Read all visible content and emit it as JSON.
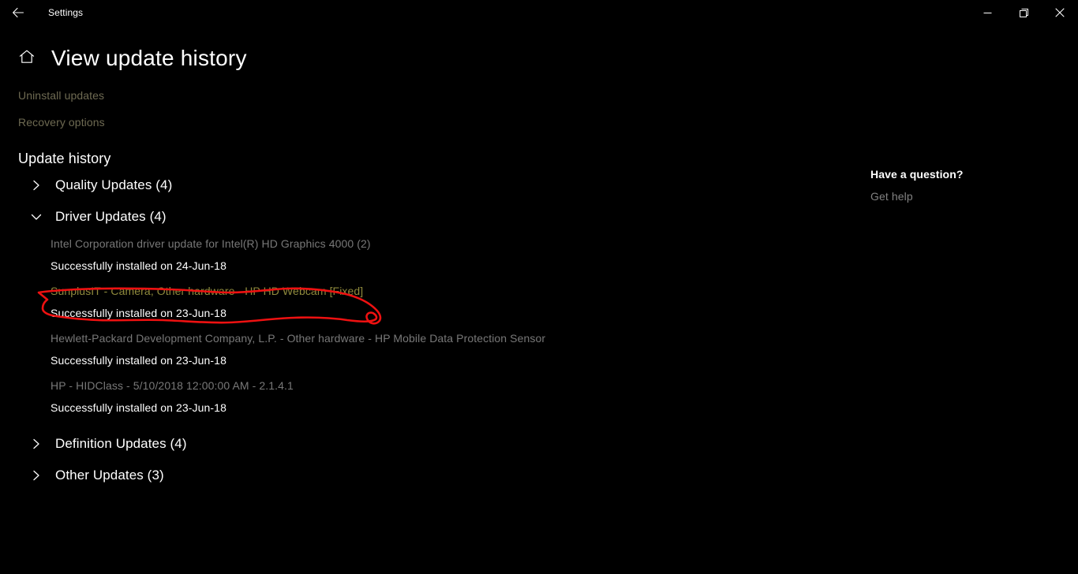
{
  "window": {
    "app_title": "Settings",
    "back_icon": "back-arrow-icon",
    "minimize_icon": "minimize-icon",
    "restore_icon": "restore-icon",
    "close_icon": "close-icon"
  },
  "header": {
    "home_icon": "home-icon",
    "title": "View update history"
  },
  "top_links": [
    {
      "label": "Uninstall updates"
    },
    {
      "label": "Recovery options"
    }
  ],
  "update_history": {
    "section_title": "Update history",
    "groups": [
      {
        "label": "Quality Updates (4)",
        "expanded": false,
        "chevron": "chevron-right-icon",
        "entries": []
      },
      {
        "label": "Driver Updates (4)",
        "expanded": true,
        "chevron": "chevron-down-icon",
        "entries": [
          {
            "title": "Intel Corporation driver update for Intel(R) HD Graphics 4000 (2)",
            "status": "Successfully installed on 24-Jun-18",
            "visited": false,
            "annotated": false
          },
          {
            "title": "SunplusIT - Camera, Other hardware - HP HD Webcam [Fixed]",
            "status": "Successfully installed on 23-Jun-18",
            "visited": true,
            "annotated": true
          },
          {
            "title": "Hewlett-Packard Development Company, L.P. - Other hardware - HP Mobile Data Protection Sensor",
            "status": "Successfully installed on 23-Jun-18",
            "visited": false,
            "annotated": false
          },
          {
            "title": "HP - HIDClass - 5/10/2018 12:00:00 AM - 2.1.4.1",
            "status": "Successfully installed on 23-Jun-18",
            "visited": false,
            "annotated": false
          }
        ]
      },
      {
        "label": "Definition Updates (4)",
        "expanded": false,
        "chevron": "chevron-right-icon",
        "entries": []
      },
      {
        "label": "Other Updates (3)",
        "expanded": false,
        "chevron": "chevron-right-icon",
        "entries": []
      }
    ]
  },
  "help_panel": {
    "heading": "Have a question?",
    "link": "Get help"
  },
  "annotation": {
    "type": "hand-drawn-circle",
    "color": "#ee1111",
    "target": "SunplusIT - Camera, Other hardware - HP HD Webcam [Fixed]"
  },
  "colors": {
    "background": "#000000",
    "text_primary": "#ffffff",
    "text_dim": "#787878",
    "link_visited": "#8f8a3c",
    "link_dim": "#6e6a52",
    "annotation_red": "#ee1111"
  }
}
